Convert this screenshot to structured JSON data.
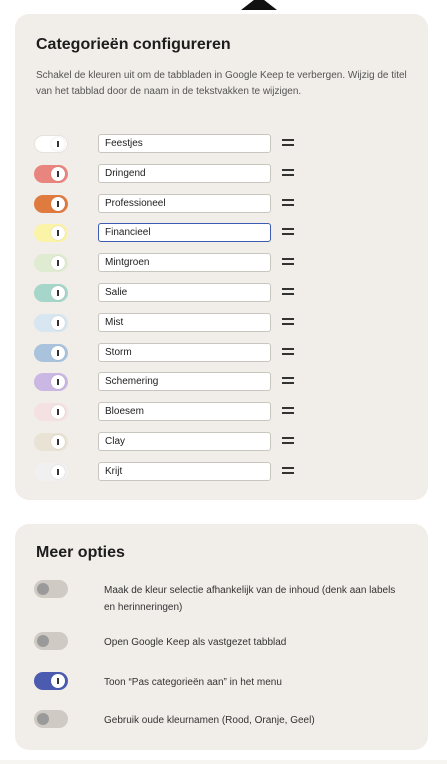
{
  "section1": {
    "title": "Categorieën configureren",
    "description": "Schakel de kleuren uit om de tabbladen in Google Keep te verbergen. Wijzig de titel van het tabblad door de naam in de tekstvakken te wijzigen."
  },
  "categories": [
    {
      "name": "Feestjes",
      "color": "#ffffff",
      "enabled": true
    },
    {
      "name": "Dringend",
      "color": "#e8857e",
      "enabled": true
    },
    {
      "name": "Professioneel",
      "color": "#e07b3f",
      "enabled": true
    },
    {
      "name": "Financieel",
      "color": "#fbf3a7",
      "enabled": true,
      "focused": true
    },
    {
      "name": "Mintgroen",
      "color": "#e0ecd2",
      "enabled": true
    },
    {
      "name": "Salie",
      "color": "#a6d6c9",
      "enabled": true
    },
    {
      "name": "Mist",
      "color": "#d7e6f0",
      "enabled": true
    },
    {
      "name": "Storm",
      "color": "#a9c3dc",
      "enabled": true
    },
    {
      "name": "Schemering",
      "color": "#cbb7e3",
      "enabled": true
    },
    {
      "name": "Bloesem",
      "color": "#f5e1e1",
      "enabled": true
    },
    {
      "name": "Clay",
      "color": "#e8e3d4",
      "enabled": true
    },
    {
      "name": "Krijt",
      "color": "#f1f0f0",
      "enabled": true
    }
  ],
  "section2": {
    "title": "Meer opties",
    "options": [
      {
        "label": "Maak de kleur selectie afhankelijk van de inhoud (denk aan labels en herinneringen)",
        "enabled": false
      },
      {
        "label": "Open Google Keep als vastgezet tabblad",
        "enabled": false
      },
      {
        "label": "Toon “Pas categorieën aan” in het menu",
        "enabled": true
      },
      {
        "label": "Gebruik oude kleurnamen (Rood, Oranje, Geel)",
        "enabled": false
      }
    ]
  }
}
